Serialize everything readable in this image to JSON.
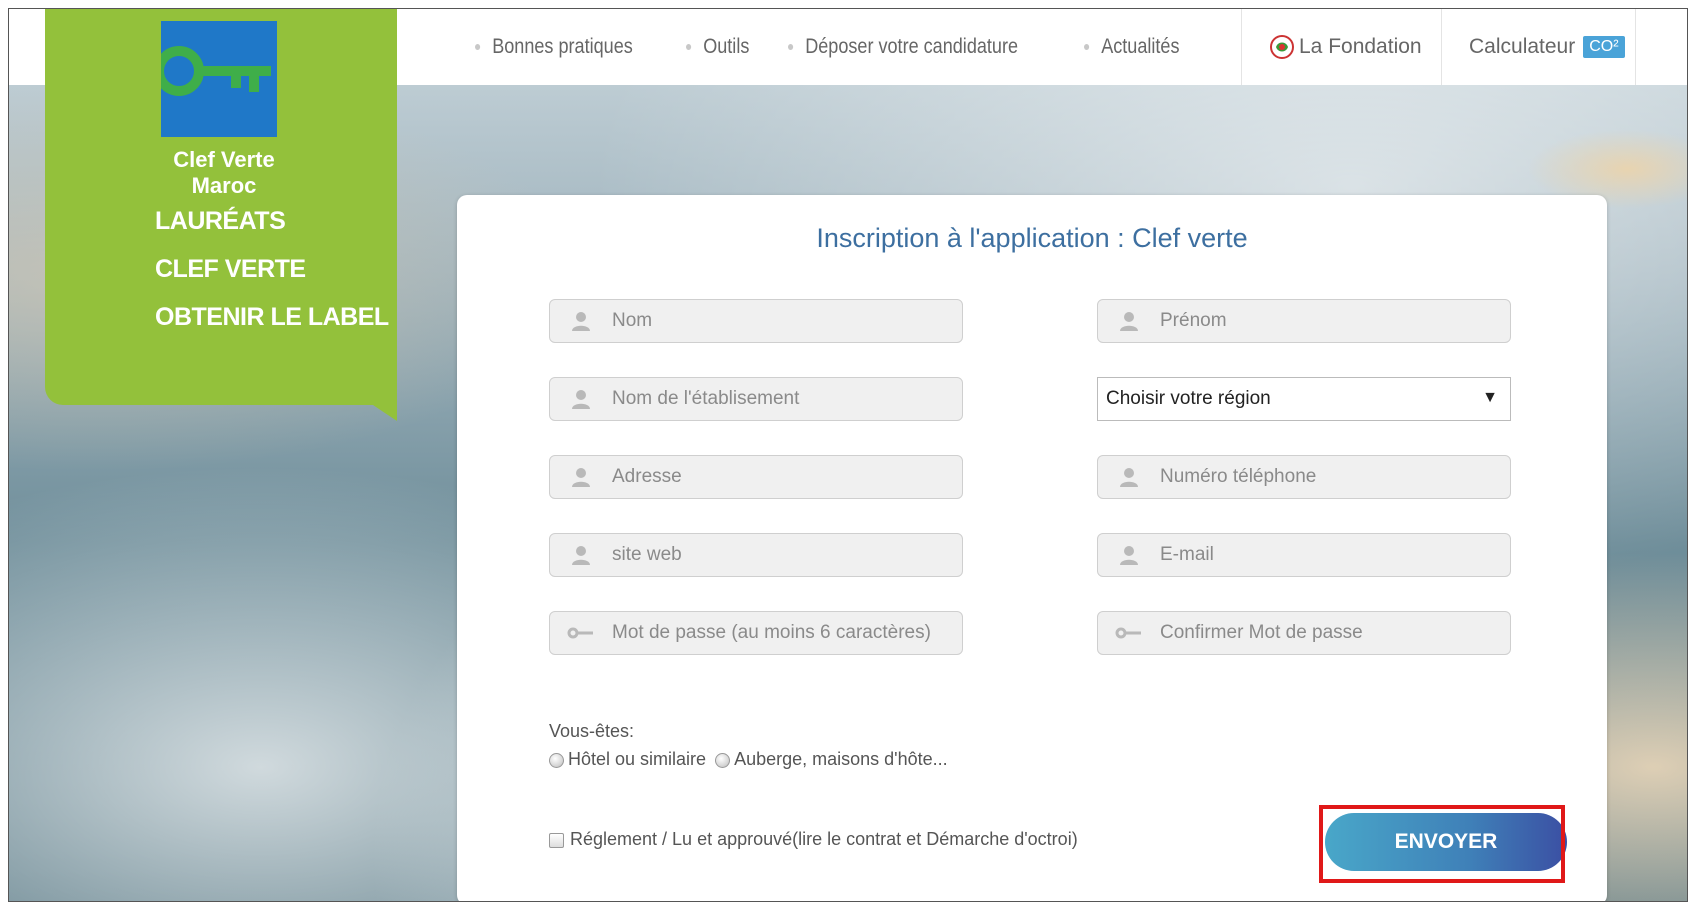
{
  "brand": {
    "line1": "Clef Verte",
    "line2": "Maroc"
  },
  "nav": {
    "items": [
      "Bonnes pratiques",
      "Outils",
      "Déposer votre candidature",
      "Actualités"
    ],
    "fondation": "La Fondation",
    "calculateur": "Calculateur",
    "co2": "CO²"
  },
  "sidebar": {
    "links": [
      "LAURÉATS",
      "CLEF VERTE",
      "OBTENIR LE LABEL"
    ]
  },
  "form": {
    "title": "Inscription à l'application : Clef verte",
    "fields": {
      "nom": "Nom",
      "prenom": "Prénom",
      "etablissement": "Nom de l'établisement",
      "region": "Choisir votre région",
      "adresse": "Adresse",
      "telephone": "Numéro téléphone",
      "site": "site web",
      "email": "E-mail",
      "password": "Mot de passe (au moins 6 caractères)",
      "confirm": "Confirmer Mot de passe"
    },
    "vous_etes": "Vous-êtes:",
    "radio1": "Hôtel ou similaire",
    "radio2": "Auberge, maisons d'hôte...",
    "reglement": "Réglement / Lu et approuvé(lire le contrat et Démarche d'octroi)",
    "submit": "ENVOYER"
  },
  "colors": {
    "accent_green": "#93c13b",
    "link_blue": "#3d6fa0",
    "highlight": "#e01818"
  }
}
